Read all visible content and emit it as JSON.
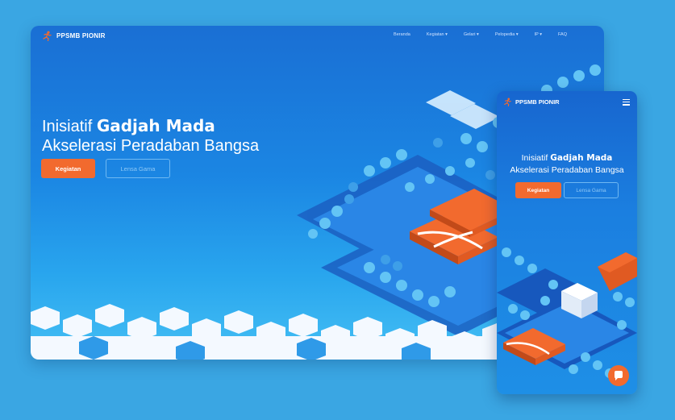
{
  "brand": {
    "name": "PPSMB PIONIR"
  },
  "nav": {
    "items": [
      {
        "label": "Beranda"
      },
      {
        "label": "Kegiatan ▾"
      },
      {
        "label": "Gelari ▾"
      },
      {
        "label": "Pelopedia ▾"
      },
      {
        "label": "IP ▾"
      },
      {
        "label": "FAQ"
      }
    ]
  },
  "hero": {
    "prefix": "Inisiatif",
    "highlight": "Gadjah Mada",
    "line2": "Akselerasi Peradaban Bangsa",
    "primary_button": "Kegiatan",
    "secondary_button": "Lensa Gama"
  },
  "colors": {
    "background": "#3aa6e3",
    "accent": "#f26a2e",
    "hero_blue": "#1a6fd4"
  },
  "icons": {
    "logo": "runner-logo-icon",
    "menu": "hamburger-menu-icon",
    "chat": "chat-bubble-icon"
  }
}
